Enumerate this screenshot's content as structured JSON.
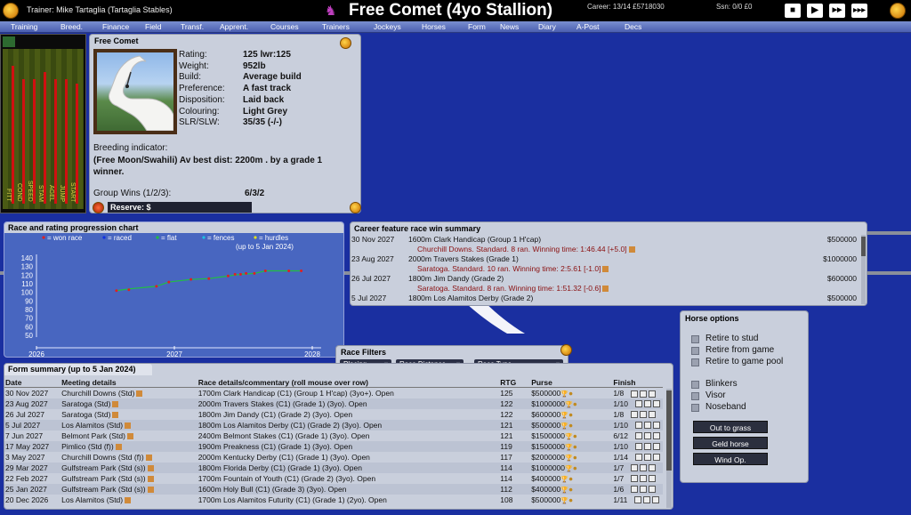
{
  "topbar": {
    "trainer": "Trainer:  Mike Tartaglia  (Tartaglia Stables)",
    "title": "Free Comet (4yo Stallion)",
    "career": "Career: 13/14  £5718030",
    "season": "Ssn: 0/0  £0",
    "controls": [
      "■",
      "▶",
      "▶▶",
      "▶▶▶"
    ]
  },
  "menu": [
    "Training",
    "Breed.",
    "Finance",
    "Field",
    "Transf.",
    "Apprent.",
    "Courses",
    "Trainers",
    "Jockeys",
    "Horses",
    "Form",
    "News",
    "Diary",
    "A-Post",
    "Decs"
  ],
  "bars": {
    "labels": [
      "FITT",
      "COND",
      "SPEED",
      "STAM",
      "AGEL",
      "JUMP",
      "START"
    ],
    "levels": [
      0.86,
      0.78,
      0.78,
      0.82,
      0.78,
      0.78,
      0.75
    ]
  },
  "horse": {
    "name": "Free Comet",
    "stats": [
      {
        "k": "Rating:",
        "v": "125 lwr:125"
      },
      {
        "k": "Weight:",
        "v": "952lb"
      },
      {
        "k": "Build:",
        "v": "Average build"
      },
      {
        "k": "Preference:",
        "v": "A fast track"
      },
      {
        "k": "Disposition:",
        "v": "Laid back"
      },
      {
        "k": "Colouring:",
        "v": "Light Grey"
      },
      {
        "k": "SLR/SLW:",
        "v": "35/35  (-/-)"
      }
    ],
    "breeding_label": "Breeding indicator:",
    "breeding_text": "(Free Moon/Swahili) Av best dist: 2200m . by a grade 1 winner.",
    "group_wins_label": "Group Wins (1/2/3):",
    "group_wins": "6/3/2",
    "reserve_label": "Reserve: $"
  },
  "chart": {
    "title": "Race and rating progression chart",
    "legend": [
      {
        "label": "= won race",
        "color": "#e02020"
      },
      {
        "label": "= raced",
        "color": "#1030e0"
      },
      {
        "label": "= flat",
        "color": "#20c040"
      },
      {
        "label": "= fences",
        "color": "#20c0e0"
      },
      {
        "label": "= hurdles",
        "color": "#e0e020"
      }
    ],
    "note": "(up to 5 Jan 2024)",
    "y_ticks": [
      "140",
      "130",
      "120",
      "110",
      "100",
      "90",
      "80",
      "70",
      "60",
      "50"
    ],
    "x_ticks": [
      "2026",
      "2027",
      "2028"
    ]
  },
  "chart_data": {
    "type": "line",
    "title": "Race and rating progression chart",
    "xlabel": "",
    "ylabel": "",
    "ylim": [
      50,
      140
    ],
    "xlim": [
      2026.0,
      2028.0
    ],
    "series": [
      {
        "name": "won race",
        "points": [
          [
            2026.58,
            102
          ],
          [
            2026.67,
            103
          ],
          [
            2026.87,
            107
          ],
          [
            2026.96,
            112
          ],
          [
            2027.12,
            115
          ],
          [
            2027.25,
            116
          ],
          [
            2027.39,
            119
          ],
          [
            2027.44,
            121
          ],
          [
            2027.48,
            121
          ],
          [
            2027.52,
            122
          ],
          [
            2027.58,
            122
          ],
          [
            2027.66,
            125
          ],
          [
            2027.83,
            125
          ],
          [
            2027.92,
            125
          ]
        ]
      }
    ],
    "rating_line": {
      "points": [
        [
          2026.58,
          102
        ],
        [
          2026.67,
          104
        ],
        [
          2026.87,
          107
        ],
        [
          2026.96,
          112
        ],
        [
          2027.12,
          115
        ],
        [
          2027.25,
          116
        ],
        [
          2027.39,
          119
        ],
        [
          2027.48,
          121
        ],
        [
          2027.58,
          122
        ],
        [
          2027.66,
          125
        ],
        [
          2027.92,
          125
        ]
      ]
    }
  },
  "summary": {
    "title": "Career feature race win summary",
    "rows": [
      {
        "date": "30 Nov 2027",
        "race": "1600m  Clark Handicap (Group 1 H'cap)",
        "purse": "$500000",
        "sub": "Churchill Downs. Standard. 8 ran.  Winning time: 1:46.44 [+5.0]"
      },
      {
        "date": "23 Aug 2027",
        "race": "2000m  Travers Stakes (Grade 1)",
        "purse": "$1000000",
        "sub": "Saratoga. Standard. 10 ran.  Winning time: 2:5.61 [-1.0]"
      },
      {
        "date": "26 Jul 2027",
        "race": "1800m  Jim Dandy (Grade 2)",
        "purse": "$600000",
        "sub": "Saratoga. Standard. 8 ran.  Winning time: 1:51.32 [-0.6]"
      },
      {
        "date": "5 Jul 2027",
        "race": "1800m  Los Alamitos Derby (Grade 2)",
        "purse": "$500000",
        "sub": ""
      }
    ]
  },
  "filters": {
    "title": "Race Filters",
    "placing": "Placing",
    "distance": "Race Distance",
    "type": "Race Type"
  },
  "form": {
    "title": "Form summary (up to 5 Jan 2024)",
    "headers": [
      "Date",
      "Meeting details",
      "Race details/commentary (roll mouse over row)",
      "RTG",
      "Purse",
      "Finish"
    ],
    "rows": [
      [
        "30 Nov 2027",
        "Churchill Downs (Std)",
        "1700m Clark Handicap (C1) (Group 1 H'cap) (3yo+). Open",
        "125",
        "$500000",
        "1/8"
      ],
      [
        "23 Aug 2027",
        "Saratoga (Std)",
        "2000m Travers Stakes (C1) (Grade 1) (3yo). Open",
        "122",
        "$1000000",
        "1/10"
      ],
      [
        "26 Jul 2027",
        "Saratoga (Std)",
        "1800m Jim Dandy (C1) (Grade 2) (3yo). Open",
        "122",
        "$600000",
        "1/8"
      ],
      [
        "5 Jul 2027",
        "Los Alamitos (Std)",
        "1800m Los Alamitos Derby (C1) (Grade 2) (3yo). Open",
        "121",
        "$500000",
        "1/10"
      ],
      [
        "7 Jun 2027",
        "Belmont Park (Std)",
        "2400m Belmont Stakes (C1) (Grade 1) (3yo). Open",
        "121",
        "$1500000",
        "6/12"
      ],
      [
        "17 May 2027",
        "Pimlico (Std (f))",
        "1900m Preakness (C1) (Grade 1) (3yo). Open",
        "119",
        "$1500000",
        "1/10"
      ],
      [
        "3 May 2027",
        "Churchill Downs (Std (f))",
        "2000m Kentucky Derby (C1) (Grade 1) (3yo). Open",
        "117",
        "$2000000",
        "1/14"
      ],
      [
        "29 Mar 2027",
        "Gulfstream Park (Std (s))",
        "1800m Florida Derby (C1) (Grade 1) (3yo). Open",
        "114",
        "$1000000",
        "1/7"
      ],
      [
        "22 Feb 2027",
        "Gulfstream Park (Std (s))",
        "1700m Fountain of Youth (C1) (Grade 2) (3yo). Open",
        "114",
        "$400000",
        "1/7"
      ],
      [
        "25 Jan 2027",
        "Gulfstream Park (Std (s))",
        "1600m Holy Bull (C1) (Grade 3) (3yo). Open",
        "112",
        "$400000",
        "1/6"
      ],
      [
        "20 Dec 2026",
        "Los Alamitos (Std)",
        "1700m Los Alamitos Futurity (C1) (Grade 1) (2yo). Open",
        "108",
        "$500000",
        "1/11"
      ]
    ]
  },
  "options": {
    "title": "Horse options",
    "checks": [
      "Retire to stud",
      "Retire from game",
      "Retire to game pool",
      "Blinkers",
      "Visor",
      "Noseband"
    ],
    "buttons": [
      "Out to grass",
      "Geld horse",
      "Wind Op."
    ]
  }
}
